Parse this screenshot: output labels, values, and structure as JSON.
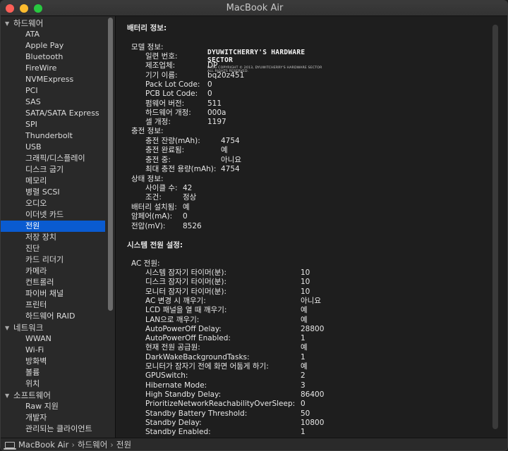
{
  "window": {
    "title": "MacBook Air",
    "traffic_colors": [
      "#fe5f57",
      "#febc2e",
      "#28c840"
    ]
  },
  "sidebar": {
    "groups": [
      {
        "label": "하드웨어",
        "items": [
          "ATA",
          "Apple Pay",
          "Bluetooth",
          "FireWire",
          "NVMExpress",
          "PCI",
          "SAS",
          "SATA/SATA Express",
          "SPI",
          "Thunderbolt",
          "USB",
          "그래픽/디스플레이",
          "디스크 굽기",
          "메모리",
          "병렬 SCSI",
          "오디오",
          "이더넷 카드",
          "전원",
          "저장 장치",
          "진단",
          "카드 리더기",
          "카메라",
          "컨트롤러",
          "파이버 채널",
          "프린터",
          "하드웨어 RAID"
        ]
      },
      {
        "label": "네트워크",
        "items": [
          "WWAN",
          "Wi-Fi",
          "방화벽",
          "볼륨",
          "위치"
        ]
      },
      {
        "label": "소프트웨어",
        "items": [
          "Raw 지원",
          "개발자",
          "관리되는 클라이언트"
        ]
      }
    ],
    "selected": "전원",
    "selection_color": "#0a5bd0"
  },
  "content": {
    "battery_title": "배터리 정보:",
    "model_label": "모델 정보:",
    "model_rows": [
      {
        "label": "일련 번호:",
        "value": ""
      },
      {
        "label": "제조업체:",
        "value": "DP"
      },
      {
        "label": "기기 이름:",
        "value": "bq20z451"
      },
      {
        "label": "Pack Lot Code:",
        "value": "0"
      },
      {
        "label": "PCB Lot Code:",
        "value": "0"
      },
      {
        "label": "펌웨어 버전:",
        "value": "511"
      },
      {
        "label": "하드웨어 개정:",
        "value": "000a"
      },
      {
        "label": "셀 개정:",
        "value": "1197"
      }
    ],
    "watermark": {
      "title": "DYUWITCHERRY'S HARDWARE SECTOR",
      "subtitle": "BLOG COPYRIGHT © 2013, DYUWITCHERRY'S HARDWARE SECTOR ALL RIGHTS RESERVED."
    },
    "charge_label": "충전 정보:",
    "charge_rows": [
      {
        "label": "충전 잔량(mAh):",
        "value": "4754"
      },
      {
        "label": "충전 완료됨:",
        "value": "예"
      },
      {
        "label": "충전 중:",
        "value": "아니요"
      },
      {
        "label": "최대 충전 용량(mAh):",
        "value": "4754"
      }
    ],
    "status_label": "상태 정보:",
    "status_rows": [
      {
        "label": "사이클 수:",
        "value": "42"
      },
      {
        "label": "조건:",
        "value": "정상"
      }
    ],
    "battery_misc": [
      {
        "label": "배터리 설치됨:",
        "value": "예"
      },
      {
        "label": "암페어(mA):",
        "value": "0"
      },
      {
        "label": "전압(mV):",
        "value": "8526"
      }
    ],
    "power_title": "시스템 전원 설정:",
    "ac_label": "AC 전원:",
    "ac_rows": [
      {
        "label": "시스템 잠자기 타이머(분):",
        "value": "10"
      },
      {
        "label": "디스크 잠자기 타이머(분):",
        "value": "10"
      },
      {
        "label": "모니터 잠자기 타이머(분):",
        "value": "10"
      },
      {
        "label": "AC 변경 시 깨우기:",
        "value": "아니요"
      },
      {
        "label": "LCD 패널을 열 때 깨우기:",
        "value": "예"
      },
      {
        "label": "LAN으로 깨우기:",
        "value": "예"
      },
      {
        "label": "AutoPowerOff Delay:",
        "value": "28800"
      },
      {
        "label": "AutoPowerOff Enabled:",
        "value": "1"
      },
      {
        "label": "현재 전원 공급원:",
        "value": "예"
      },
      {
        "label": "DarkWakeBackgroundTasks:",
        "value": "1"
      },
      {
        "label": "모니터가 잠자기 전에 화면 어둡게 하기:",
        "value": "예"
      },
      {
        "label": "GPUSwitch:",
        "value": "2"
      },
      {
        "label": "Hibernate Mode:",
        "value": "3"
      },
      {
        "label": "High Standby Delay:",
        "value": "86400"
      },
      {
        "label": "PrioritizeNetworkReachabilityOverSleep:",
        "value": "0"
      },
      {
        "label": "Standby Battery Threshold:",
        "value": "50"
      },
      {
        "label": "Standby Delay:",
        "value": "10800"
      },
      {
        "label": "Standby Enabled:",
        "value": "1"
      }
    ]
  },
  "statusbar": {
    "crumbs": [
      "MacBook Air",
      "하드웨어",
      "전원"
    ],
    "separator": "›"
  }
}
